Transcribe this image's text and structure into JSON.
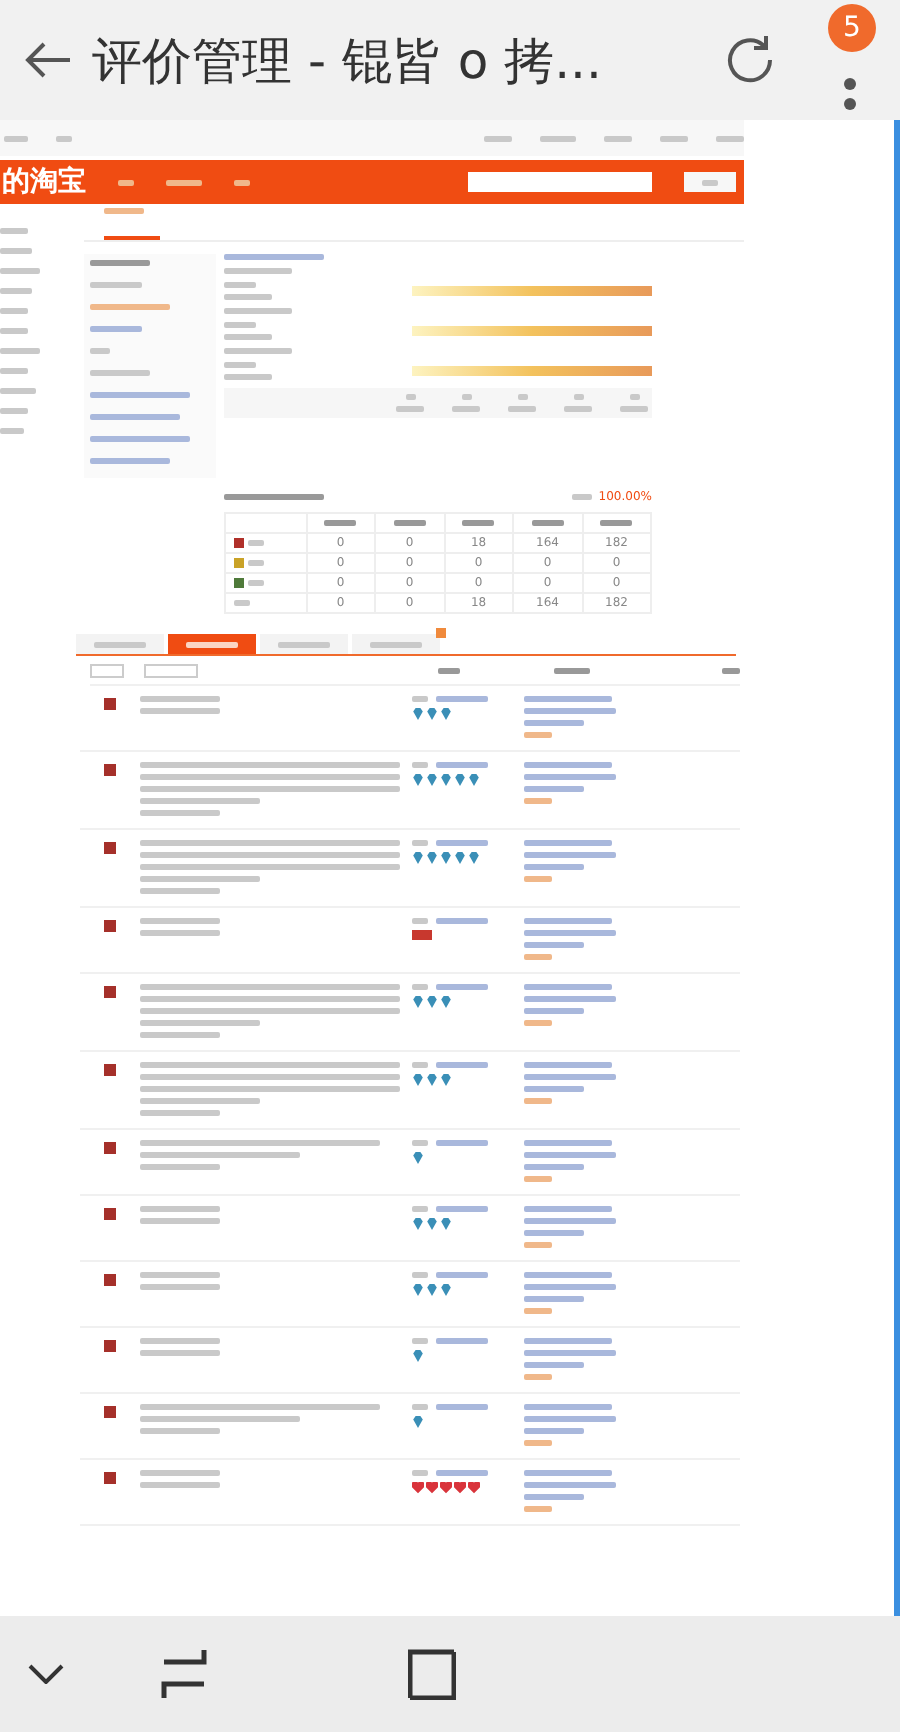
{
  "browser_bar": {
    "title": "评价管理 - 锟皆 o 拷...",
    "tab_count": "5"
  },
  "header": {
    "logo": "的淘宝"
  },
  "stats_table": {
    "rate": "100.00%",
    "rows": [
      {
        "kind": "good",
        "values": [
          "0",
          "0",
          "18",
          "164",
          "182"
        ]
      },
      {
        "kind": "neutral",
        "values": [
          "0",
          "0",
          "0",
          "0",
          "0"
        ]
      },
      {
        "kind": "bad",
        "values": [
          "0",
          "0",
          "0",
          "0",
          "0"
        ]
      },
      {
        "kind": "total",
        "values": [
          "0",
          "0",
          "18",
          "164",
          "182"
        ]
      }
    ]
  },
  "tabs": [
    {
      "selected": false
    },
    {
      "selected": true
    },
    {
      "selected": false
    },
    {
      "selected": false
    }
  ],
  "reviews": [
    {
      "kind": "short",
      "rating": {
        "kind": "diamond",
        "stars": 3
      }
    },
    {
      "kind": "long",
      "rating": {
        "kind": "diamond",
        "stars": 5
      }
    },
    {
      "kind": "long",
      "rating": {
        "kind": "diamond",
        "stars": 5
      }
    },
    {
      "kind": "short",
      "rating": {
        "kind": "badge"
      }
    },
    {
      "kind": "long",
      "rating": {
        "kind": "diamond",
        "stars": 3
      }
    },
    {
      "kind": "long",
      "rating": {
        "kind": "diamond",
        "stars": 3
      }
    },
    {
      "kind": "medium",
      "rating": {
        "kind": "single-diamond"
      }
    },
    {
      "kind": "short",
      "rating": {
        "kind": "diamond",
        "stars": 3
      }
    },
    {
      "kind": "short",
      "rating": {
        "kind": "diamond",
        "stars": 3
      }
    },
    {
      "kind": "short",
      "rating": {
        "kind": "single-diamond"
      }
    },
    {
      "kind": "medium",
      "rating": {
        "kind": "single-diamond"
      }
    },
    {
      "kind": "short",
      "rating": {
        "kind": "heart",
        "stars": 5
      }
    }
  ]
}
